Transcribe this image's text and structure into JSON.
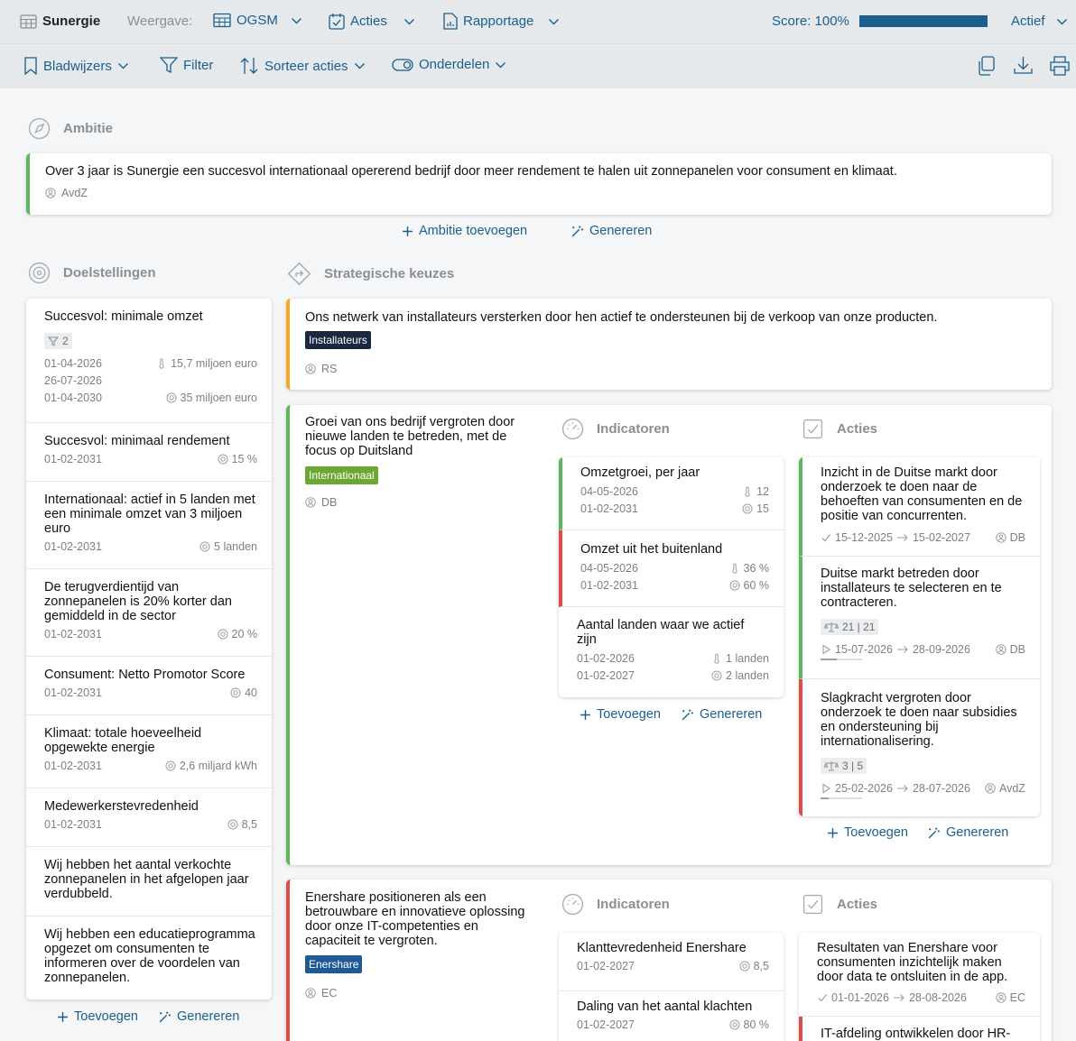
{
  "topbar": {
    "app_name": "Sunergie",
    "view_label": "Weergave:",
    "views": [
      {
        "label": "OGSM"
      },
      {
        "label": "Acties"
      },
      {
        "label": "Rapportage"
      }
    ],
    "score_label": "Score: 100%",
    "score_value": 100,
    "status_label": "Actief"
  },
  "toolbar": {
    "bookmarks": "Bladwijzers",
    "filter": "Filter",
    "sort": "Sorteer acties",
    "parts": "Onderdelen"
  },
  "ambition": {
    "heading": "Ambitie",
    "text": "Over 3 jaar is Sunergie een succesvol internationaal opererend bedrijf door meer rendement te halen uit zonnepanelen voor consument en klimaat.",
    "owner": "AvdZ",
    "add_label": "Ambitie toevoegen",
    "generate_label": "Genereren"
  },
  "objectives": {
    "heading": "Doelstellingen",
    "add_label": "Toevoegen",
    "generate_label": "Genereren",
    "items": [
      {
        "title": "Succesvol: minimale omzet",
        "chip": "2",
        "date1": "01-04-2026",
        "date2": "26-07-2026",
        "date3": "01-04-2030",
        "current": "15,7 miljoen euro",
        "target": "35 miljoen euro"
      },
      {
        "title": "Succesvol: minimaal rendement",
        "date": "01-02-2031",
        "target": "15 %"
      },
      {
        "title": "Internationaal: actief in 5 landen met een minimale omzet van 3 miljoen euro",
        "date": "01-02-2031",
        "target": "5 landen"
      },
      {
        "title": "De terugverdientijd van zonnepanelen is 20% korter dan gemiddeld in de sector",
        "date": "01-02-2031",
        "target": "20 %"
      },
      {
        "title": "Consument: Netto Promotor Score",
        "date": "01-02-2031",
        "target": "40"
      },
      {
        "title": "Klimaat: totale hoeveelheid opgewekte energie",
        "date": "01-02-2031",
        "target": "2,6 miljard kWh"
      },
      {
        "title": "Medewerkerstevredenheid",
        "date": "01-02-2031",
        "target": "8,5"
      },
      {
        "title": "Wij hebben het aantal verkochte zonnepanelen in het afgelopen jaar verdubbeld."
      },
      {
        "title": "Wij hebben een educatieprogramma opgezet om consumenten te informeren over de voordelen van zonnepanelen."
      }
    ]
  },
  "strategies": {
    "heading": "Strategische keuzes",
    "indicators_heading": "Indicatoren",
    "actions_heading": "Acties",
    "add_label": "Toevoegen",
    "generate_label": "Genereren",
    "s1": {
      "text": "Ons netwerk van installateurs versterken door hen actief te ondersteunen bij de verkoop van onze producten.",
      "tag": "Installateurs",
      "owner": "RS"
    },
    "s2": {
      "text": "Groei van ons bedrijf vergroten door nieuwe landen te betreden, met de focus op Duitsland",
      "tag": "Internationaal",
      "owner": "DB",
      "indicators": [
        {
          "title": "Omzetgroei, per jaar",
          "date1": "04-05-2026",
          "date2": "01-02-2031",
          "current": "12",
          "target": "15"
        },
        {
          "title": "Omzet uit het buitenland",
          "date1": "04-05-2026",
          "date2": "01-02-2031",
          "current": "36 %",
          "target": "60 %"
        },
        {
          "title": "Aantal landen waar we actief zijn",
          "date1": "01-02-2026",
          "date2": "01-02-2027",
          "current": "1 landen",
          "target": "2 landen"
        }
      ],
      "actions": [
        {
          "title": "Inzicht in de Duitse markt door onderzoek te doen naar de behoeften van consumenten en de positie van concurrenten.",
          "start": "15-12-2025",
          "end": "15-02-2027",
          "owner": "DB"
        },
        {
          "title": "Duitse markt betreden door installateurs te selecteren en te contracteren.",
          "chip": "21 | 21",
          "start": "15-07-2026",
          "end": "28-09-2026",
          "owner": "DB",
          "progress": 0.4
        },
        {
          "title": "Slagkracht vergroten door onderzoek te doen naar subsidies en ondersteuning bij internationalisering.",
          "chip": "3 | 5",
          "start": "25-02-2026",
          "end": "28-07-2026",
          "owner": "AvdZ",
          "progress": 0.2
        }
      ]
    },
    "s3": {
      "text": "Enershare positioneren als een betrouwbare en innovatieve oplossing door onze IT-competenties en capaciteit te vergroten.",
      "tag": "Enershare",
      "owner": "EC",
      "indicators": [
        {
          "title": "Klanttevredenheid Enershare",
          "date": "01-02-2027",
          "target": "8,5"
        },
        {
          "title": "Daling van het aantal klachten",
          "date": "01-02-2027",
          "target": "80 %"
        }
      ],
      "actions": [
        {
          "title": "Resultaten van Enershare voor consumenten inzichtelijk maken door data te ontsluiten in de app.",
          "start": "01-01-2026",
          "end": "28-08-2026",
          "owner": "EC"
        },
        {
          "title": "IT-afdeling ontwikkelen door HR-"
        }
      ]
    }
  },
  "colors": {
    "accent": "#1a5e8f",
    "green": "#5cb85c",
    "red": "#e04a4a",
    "orange": "#f5a623",
    "tag_navy": "#1b2940",
    "tag_green": "#6aa832",
    "tag_blue": "#1f5a96"
  }
}
